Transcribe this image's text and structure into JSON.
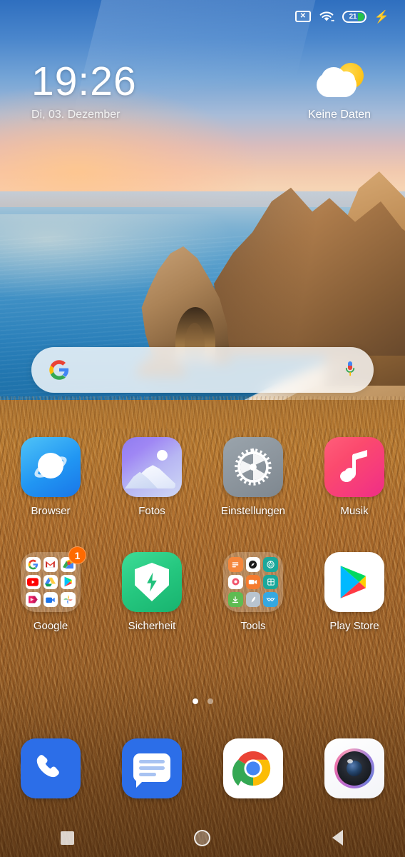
{
  "status_bar": {
    "sim_icon": "no-sim-icon",
    "sim_glyph": "✕",
    "wifi_icon": "wifi-icon",
    "battery_level": "21",
    "battery_color": "#25c24a",
    "charging_icon": "charging-bolt-icon",
    "charging_glyph": "⚡"
  },
  "clock_widget": {
    "time": "19:26",
    "date": "Di, 03. Dezember"
  },
  "weather_widget": {
    "icon": "partly-cloudy-icon",
    "text": "Keine Daten"
  },
  "search": {
    "logo_icon": "google-g-icon",
    "mic_icon": "microphone-icon",
    "placeholder": "",
    "value": ""
  },
  "apps": {
    "row1": [
      {
        "label": "Browser",
        "icon": "browser-icon"
      },
      {
        "label": "Fotos",
        "icon": "photos-icon"
      },
      {
        "label": "Einstellungen",
        "icon": "settings-gear-icon"
      },
      {
        "label": "Musik",
        "icon": "music-note-icon"
      }
    ],
    "row2": [
      {
        "label": "Google",
        "icon": "google-folder-icon",
        "badge": "1",
        "mini_icons": [
          "google-g-icon",
          "gmail-icon",
          "maps-icon",
          "youtube-icon",
          "drive-icon",
          "play-store-icon",
          "play-movies-icon",
          "meet-icon",
          "photos-icon"
        ]
      },
      {
        "label": "Sicherheit",
        "icon": "security-shield-icon"
      },
      {
        "label": "Tools",
        "icon": "tools-folder-icon",
        "mini_icons": [
          "notes-icon",
          "compass-icon",
          "recorder-icon",
          "clock-icon",
          "screen-recorder-icon",
          "calculator-icon",
          "downloads-icon",
          "cleaner-icon",
          "scanner-icon"
        ]
      },
      {
        "label": "Play Store",
        "icon": "play-store-icon"
      }
    ]
  },
  "page_indicator": {
    "total": 2,
    "active": 1
  },
  "dock": [
    {
      "label": "Phone",
      "icon": "phone-icon"
    },
    {
      "label": "Messages",
      "icon": "messages-icon"
    },
    {
      "label": "Chrome",
      "icon": "chrome-icon"
    },
    {
      "label": "Camera",
      "icon": "camera-icon"
    }
  ],
  "nav_bar": [
    {
      "label": "Recents",
      "icon": "recents-square-icon"
    },
    {
      "label": "Home",
      "icon": "home-circle-icon"
    },
    {
      "label": "Back",
      "icon": "back-triangle-icon"
    }
  ],
  "colors": {
    "accent_green": "#25c24a",
    "badge_orange": "#ff6a00",
    "dock_blue": "#2c6ee8"
  }
}
